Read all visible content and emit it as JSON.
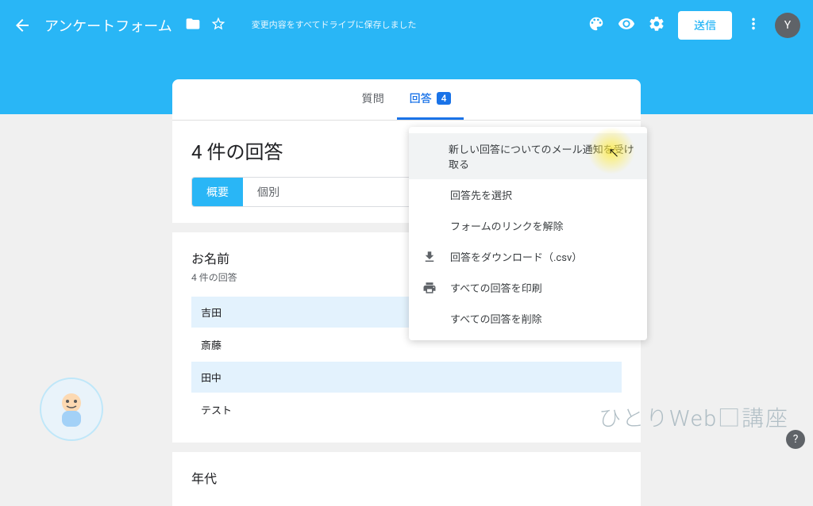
{
  "header": {
    "title": "アンケートフォーム",
    "save_status": "変更内容をすべてドライブに保存しました",
    "send_label": "送信",
    "avatar_letter": "Y"
  },
  "tabs": {
    "questions": "質問",
    "responses": "回答",
    "responses_count": "4"
  },
  "responses": {
    "title": "4 件の回答",
    "toggle_summary": "概要",
    "toggle_individual": "個別"
  },
  "question1": {
    "title": "お名前",
    "subtitle": "4 件の回答",
    "answers": [
      "吉田",
      "斎藤",
      "田中",
      "テスト"
    ]
  },
  "question2": {
    "title": "年代"
  },
  "menu": {
    "items": [
      "新しい回答についてのメール通知を受け取る",
      "回答先を選択",
      "フォームのリンクを解除",
      "回答をダウンロード（.csv）",
      "すべての回答を印刷",
      "すべての回答を削除"
    ]
  },
  "watermark": "ひとりWeb□講座"
}
